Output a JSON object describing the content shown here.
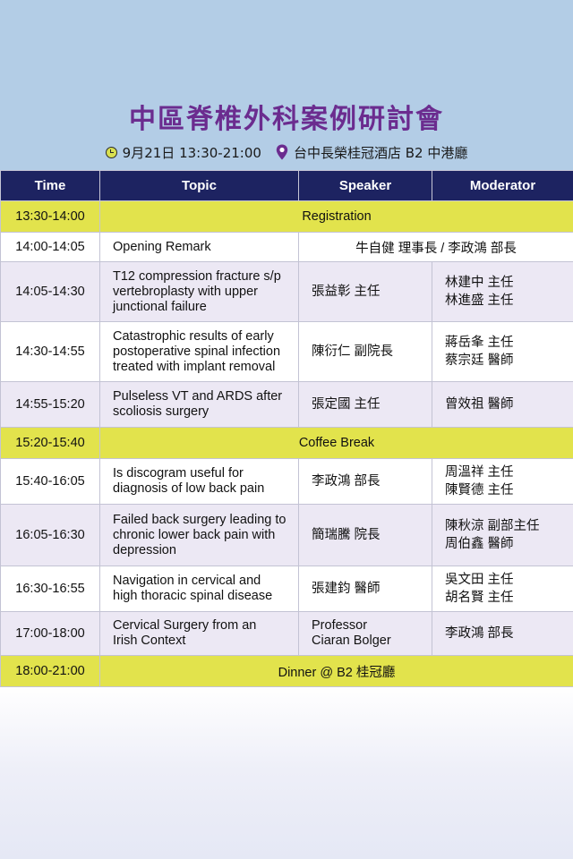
{
  "header": {
    "title": "中區脊椎外科案例研討會",
    "datetime": "9月21日 13:30-21:00",
    "venue": "台中長榮桂冠酒店 B2 中港廳"
  },
  "table": {
    "columns": [
      "Time",
      "Topic",
      "Speaker",
      "Moderator"
    ],
    "rows": [
      {
        "time": "13:30-14:00",
        "span": "Registration"
      },
      {
        "time": "14:00-14:05",
        "topic": "Opening Remark",
        "speaker_span": "牛自健 理事長 / 李政鴻 部長"
      },
      {
        "time": "14:05-14:30",
        "topic": [
          "T12 compression fracture s/p",
          "vertebroplasty with upper",
          "junctional failure"
        ],
        "speaker": [
          "張益彰 主任"
        ],
        "moderator": [
          "林建中 主任",
          "林進盛 主任"
        ]
      },
      {
        "time": "14:30-14:55",
        "topic": [
          "Catastrophic results of early",
          "postoperative spinal infection",
          "treated with implant removal"
        ],
        "speaker": [
          "陳衍仁 副院長"
        ],
        "moderator": [
          "蔣岳夆 主任",
          "蔡宗廷 醫師"
        ]
      },
      {
        "time": "14:55-15:20",
        "topic": [
          "Pulseless VT and ARDS after",
          "scoliosis surgery"
        ],
        "speaker": [
          "張定國 主任"
        ],
        "moderator": [
          "曾效祖 醫師"
        ]
      },
      {
        "time": "15:20-15:40",
        "span": "Coffee Break"
      },
      {
        "time": "15:40-16:05",
        "topic": [
          "Is discogram useful for",
          "diagnosis of low back pain"
        ],
        "speaker": [
          "李政鴻 部長"
        ],
        "moderator": [
          "周溫祥 主任",
          "陳賢德 主任"
        ]
      },
      {
        "time": "16:05-16:30",
        "topic": [
          "Failed back surgery leading to",
          "chronic lower back pain with",
          "depression"
        ],
        "speaker": [
          "簡瑞騰 院長"
        ],
        "moderator": [
          "陳秋涼 副部主任",
          "周伯鑫 醫師"
        ]
      },
      {
        "time": "16:30-16:55",
        "topic": [
          "Navigation in cervical and",
          "high thoracic spinal disease"
        ],
        "speaker": [
          "張建鈞 醫師"
        ],
        "moderator": [
          "吳文田 主任",
          "胡名賢 主任"
        ]
      },
      {
        "time": "17:00-18:00",
        "topic": [
          "Cervical Surgery from an",
          "Irish Context"
        ],
        "speaker": [
          "Professor",
          "Ciaran Bolger"
        ],
        "moderator": [
          "李政鴻 部長"
        ]
      },
      {
        "time": "18:00-21:00",
        "span": "Dinner @ B2 桂冠廳"
      }
    ]
  },
  "colors": {
    "title": "#6b2c8f",
    "header_bg": "#1d2361",
    "highlight": "#e2e34c",
    "band": "#ece8f4",
    "pin": "#6b2c8f"
  },
  "icons": [
    "clock-icon",
    "location-pin-icon"
  ]
}
